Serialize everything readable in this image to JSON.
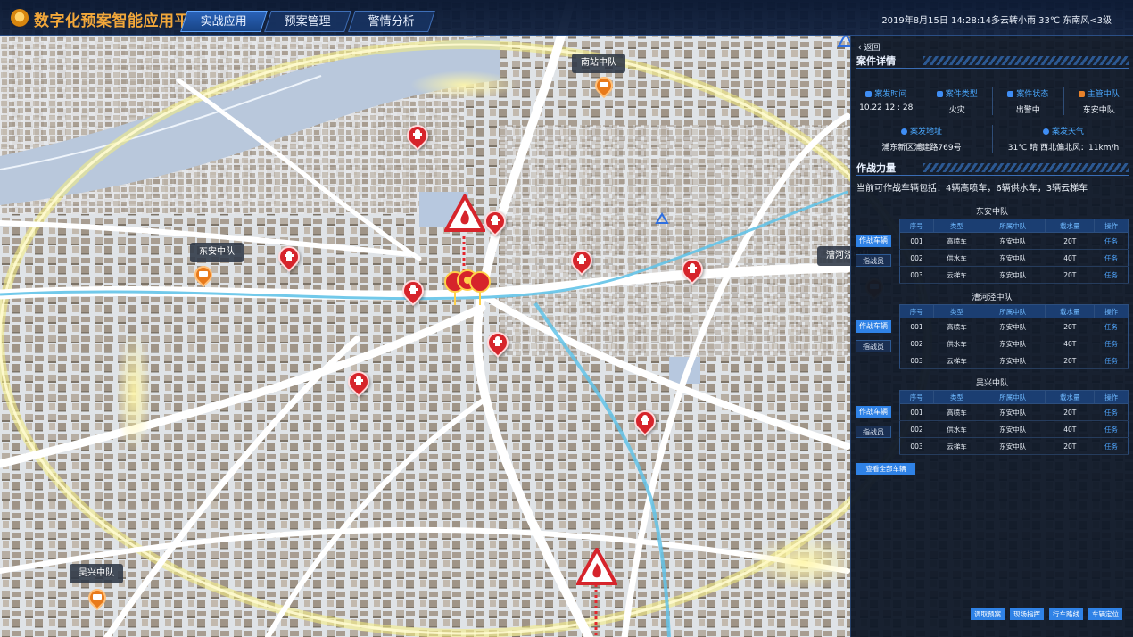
{
  "header": {
    "title": "数字化预案智能应用平台",
    "tabs": [
      {
        "label": "实战应用",
        "active": true
      },
      {
        "label": "预案管理",
        "active": false
      },
      {
        "label": "警情分析",
        "active": false
      }
    ],
    "datetime_weather": "2019年8月15日 14:28:14多云转小雨  33℃  东南风<3级"
  },
  "map": {
    "station_labels": [
      "南站中队",
      "东安中队",
      "漕河泾中队",
      "吴兴中队"
    ]
  },
  "panel": {
    "back_label": "返回",
    "case_section_title": "案件详情",
    "case_info": [
      {
        "label": "案发时间",
        "value": "10.22 12 : 28"
      },
      {
        "label": "案件类型",
        "value": "火灾"
      },
      {
        "label": "案件状态",
        "value": "出警中"
      },
      {
        "label": "主管中队",
        "value": "东安中队"
      }
    ],
    "case_info2": [
      {
        "label": "案发地址",
        "value": "浦东新区浦建路769号"
      },
      {
        "label": "案发天气",
        "value": "31℃ 晴 西北偏北风：11km/h"
      }
    ],
    "force_section_title": "作战力量",
    "force_summary": "当前可作战车辆包括：4辆高喷车，6辆供水车，3辆云梯车",
    "table_headers": [
      "序号",
      "类型",
      "所属中队",
      "载水量",
      "操作"
    ],
    "squads": [
      {
        "name": "东安中队",
        "buttons": [
          "作战车辆",
          "指战员"
        ],
        "rows": [
          [
            "001",
            "高喷车",
            "东安中队",
            "20T",
            "任务"
          ],
          [
            "002",
            "供水车",
            "东安中队",
            "40T",
            "任务"
          ],
          [
            "003",
            "云梯车",
            "东安中队",
            "20T",
            "任务"
          ]
        ]
      },
      {
        "name": "漕河泾中队",
        "buttons": [
          "作战车辆",
          "指战员"
        ],
        "rows": [
          [
            "001",
            "高喷车",
            "东安中队",
            "20T",
            "任务"
          ],
          [
            "002",
            "供水车",
            "东安中队",
            "40T",
            "任务"
          ],
          [
            "003",
            "云梯车",
            "东安中队",
            "20T",
            "任务"
          ]
        ]
      },
      {
        "name": "吴兴中队",
        "buttons": [
          "作战车辆",
          "指战员"
        ],
        "rows": [
          [
            "001",
            "高喷车",
            "东安中队",
            "20T",
            "任务"
          ],
          [
            "002",
            "供水车",
            "东安中队",
            "40T",
            "任务"
          ],
          [
            "003",
            "云梯车",
            "东安中队",
            "20T",
            "任务"
          ]
        ]
      }
    ],
    "view_all_label": "查看全部车辆",
    "bottom_buttons": [
      "调取预案",
      "现场指挥",
      "行车路线",
      "车辆定位"
    ]
  }
}
